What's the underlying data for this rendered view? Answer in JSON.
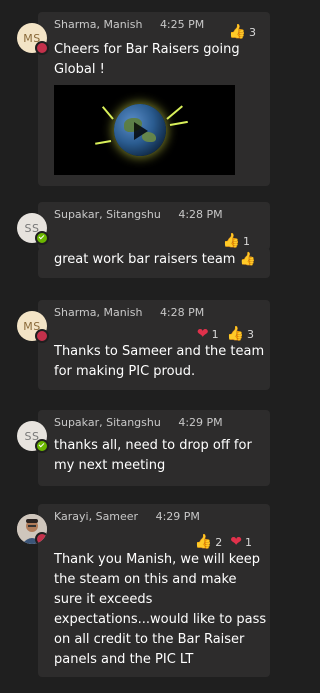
{
  "messages": [
    {
      "author": "Sharma, Manish",
      "initials": "MS",
      "time": "4:25 PM",
      "status": "busy",
      "reactions": [
        {
          "icon": "thumbs-up",
          "emoji": "👍",
          "count": "3"
        }
      ],
      "text": [
        "Cheers for Bar Raisers going",
        "Global !"
      ],
      "has_video": true
    },
    {
      "author": "Supakar, Sitangshu",
      "initials": "SS",
      "time": "4:28 PM",
      "status": "available",
      "reactions": [
        {
          "icon": "thumbs-up",
          "emoji": "👍",
          "count": "1"
        }
      ],
      "text": [
        "great work bar raisers team 👍"
      ]
    },
    {
      "author": "Sharma, Manish",
      "initials": "MS",
      "time": "4:28 PM",
      "status": "busy",
      "reactions": [
        {
          "icon": "heart",
          "emoji": "❤",
          "count": "1"
        },
        {
          "icon": "thumbs-up",
          "emoji": "👍",
          "count": "3"
        }
      ],
      "text": [
        "Thanks to Sameer and the team",
        "for making PIC proud."
      ]
    },
    {
      "author": "Supakar, Sitangshu",
      "initials": "SS",
      "time": "4:29 PM",
      "status": "available",
      "reactions": [],
      "text": [
        "thanks all, need to drop off for",
        "my next meeting"
      ]
    },
    {
      "author": "Karayi, Sameer",
      "initials": "",
      "time": "4:29 PM",
      "status": "busy",
      "reactions": [
        {
          "icon": "thumbs-up",
          "emoji": "👍",
          "count": "2"
        },
        {
          "icon": "heart",
          "emoji": "❤",
          "count": "1"
        }
      ],
      "text": [
        "Thank you Manish, we will keep",
        "the steam on this and make",
        "sure it exceeds",
        "expectations...would like to pass",
        "on all credit to the Bar Raiser",
        "panels and the PIC LT"
      ]
    }
  ],
  "colors": {
    "background": "#1f1f1f",
    "bubble": "#2d2c2c",
    "busy": "#c4314b",
    "available": "#6bb700",
    "heart": "#e0314b",
    "thumbs": "#f4c03a"
  }
}
